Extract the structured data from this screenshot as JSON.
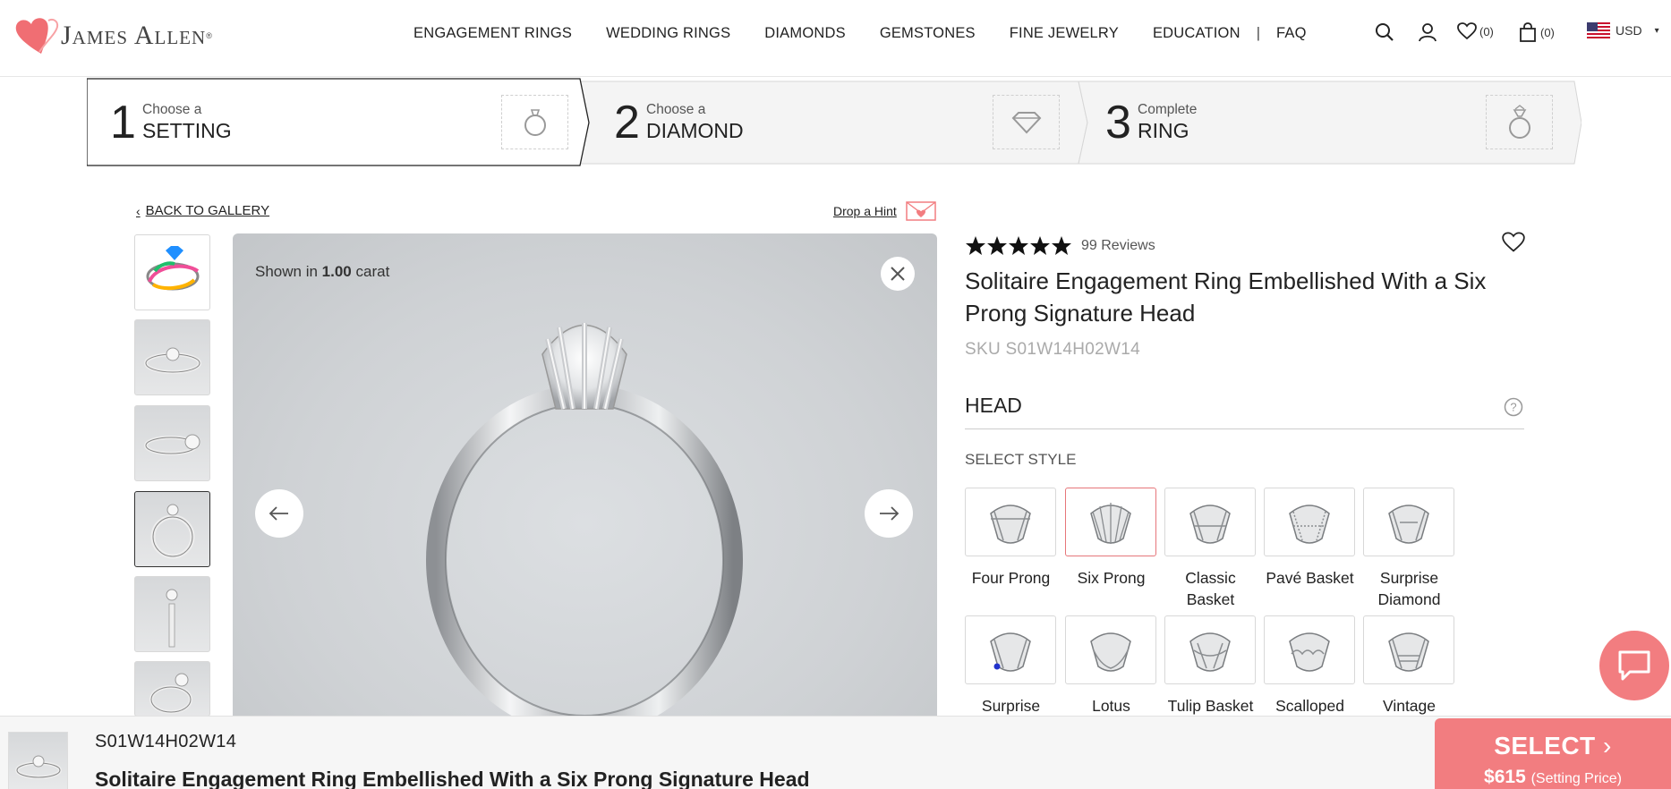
{
  "brand": {
    "name": "James Allen"
  },
  "nav": {
    "items": [
      "ENGAGEMENT RINGS",
      "WEDDING RINGS",
      "DIAMONDS",
      "GEMSTONES",
      "FINE JEWELRY",
      "EDUCATION"
    ],
    "separator": "|",
    "faq": "FAQ"
  },
  "utils": {
    "wishlist_count": "(0)",
    "cart_count": "(0)",
    "currency": "USD"
  },
  "steps": [
    {
      "num": "1",
      "small": "Choose a",
      "big": "SETTING",
      "icon": "ring-icon"
    },
    {
      "num": "2",
      "small": "Choose a",
      "big": "DIAMOND",
      "icon": "diamond-icon"
    },
    {
      "num": "3",
      "small": "Complete",
      "big": "RING",
      "icon": "complete-ring-icon"
    }
  ],
  "back_link": "BACK TO GALLERY",
  "hint_link": "Drop a Hint",
  "viewer": {
    "shown_prefix": "Shown in",
    "carat": "1.00",
    "carat_unit": "carat"
  },
  "product": {
    "rating": 5,
    "reviews": "99 Reviews",
    "title": "Solitaire Engagement Ring Embellished With a Six Prong Signature Head",
    "sku": "SKU S01W14H02W14"
  },
  "head_section": {
    "label": "HEAD",
    "select_style": "SELECT STYLE",
    "selected": "Six Prong",
    "styles": [
      "Four Prong",
      "Six Prong",
      "Classic Basket",
      "Pavé Basket",
      "Surprise Diamond",
      "Surprise",
      "Lotus",
      "Tulip Basket",
      "Scalloped",
      "Vintage"
    ]
  },
  "bottom_bar": {
    "sku": "S01W14H02W14",
    "title": "Solitaire Engagement Ring Embellished With a Six Prong Signature Head",
    "select_label": "SELECT",
    "price": "$615",
    "price_note": "(Setting Price)"
  },
  "colors": {
    "accent": "#f27d80",
    "logo_heart": "#f06e73",
    "selected_border": "#e6767a"
  }
}
